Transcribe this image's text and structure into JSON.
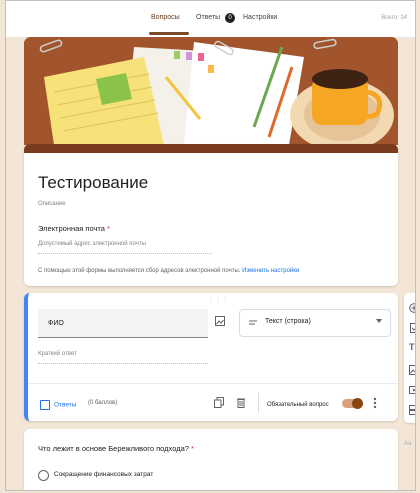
{
  "tabs": [
    {
      "label": "Вопросы",
      "active": true
    },
    {
      "label": "Ответы",
      "badge": "0"
    },
    {
      "label": "Настройки"
    }
  ],
  "total": "Всего: 14",
  "form": {
    "title": "Тестирование",
    "description_placeholder": "Описание",
    "email_label": "Электронная почта",
    "email_required": "*",
    "email_placeholder": "Допустимый адрес электронной почты",
    "collect_note": "С помощью этой формы выполняется сбор адресов электронной почты.",
    "collect_link": "Изменить настройки"
  },
  "question1": {
    "title": "ФИО",
    "type": "Текст (строка)",
    "answer_placeholder": "Краткий ответ",
    "answers_label": "Ответы",
    "points": "(0 баллов)",
    "required_label": "Обязательный вопрос"
  },
  "question2": {
    "title": "Что лежит в основе Бережливого подхода?",
    "required": "*",
    "option1": "Сокращение финансовых затрат"
  },
  "side_faded_text": "Аа",
  "colors": {
    "accent": "#7a3a1c",
    "blue": "#4285f4",
    "background": "#f3e6d6"
  }
}
